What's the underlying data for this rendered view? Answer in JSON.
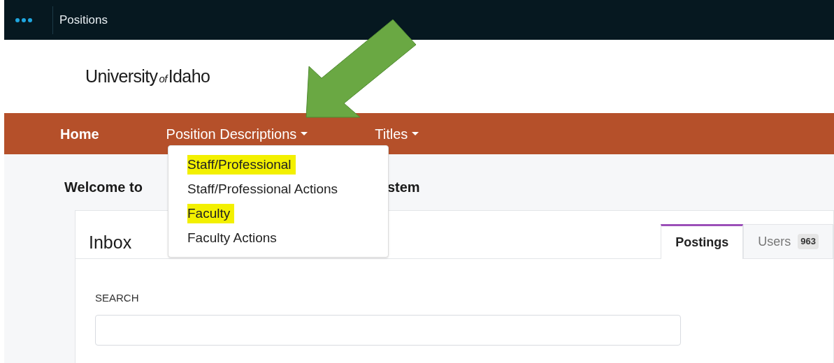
{
  "top_bar": {
    "title": "Positions"
  },
  "logo": {
    "before": "University",
    "small": "of",
    "after": "Idaho"
  },
  "nav": [
    {
      "label": "Home",
      "bold": true,
      "dropdown": false
    },
    {
      "label": "Position Descriptions",
      "bold": false,
      "dropdown": true
    },
    {
      "label": "Titles",
      "bold": false,
      "dropdown": true
    }
  ],
  "dropdown_menu": [
    {
      "label": "Staff/Professional",
      "highlighted": true
    },
    {
      "label": "Staff/Professional Actions",
      "highlighted": false
    },
    {
      "label": "Faculty",
      "highlighted": true
    },
    {
      "label": "Faculty Actions",
      "highlighted": false
    }
  ],
  "welcome": {
    "visible_start": "Welcome to",
    "visible_end": "stem"
  },
  "inbox": {
    "title": "Inbox",
    "tabs": [
      {
        "label": "Postings",
        "selected": true
      },
      {
        "label": "Users",
        "badge": "963",
        "selected": false
      }
    ],
    "search_label": "SEARCH"
  }
}
